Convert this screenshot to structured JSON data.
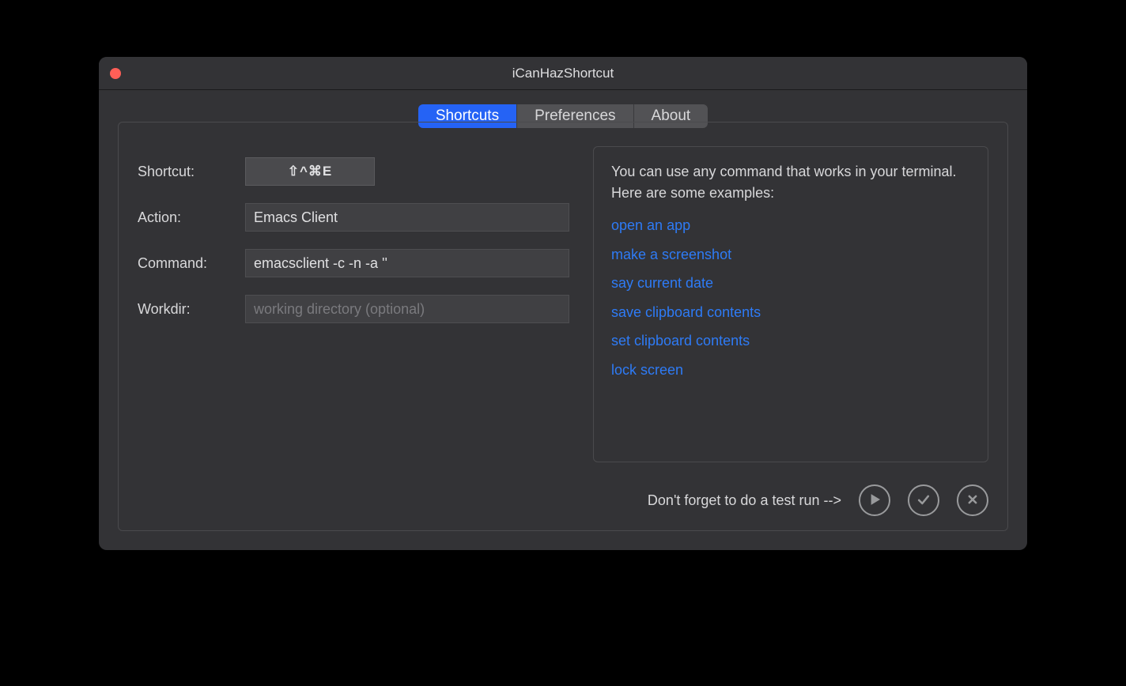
{
  "window": {
    "title": "iCanHazShortcut"
  },
  "tabs": {
    "shortcuts": "Shortcuts",
    "preferences": "Preferences",
    "about": "About",
    "active": "shortcuts"
  },
  "form": {
    "shortcut_label": "Shortcut:",
    "shortcut_value": "⇧^⌘E",
    "action_label": "Action:",
    "action_value": "Emacs Client",
    "command_label": "Command:",
    "command_value": "emacsclient -c -n -a ''",
    "workdir_label": "Workdir:",
    "workdir_value": "",
    "workdir_placeholder": "working directory (optional)"
  },
  "info": {
    "intro": "You can use any command that works in your terminal. Here are some examples:",
    "examples": [
      "open an app",
      "make a screenshot",
      "say current date",
      "save clipboard contents",
      "set clipboard contents",
      "lock screen"
    ]
  },
  "footer": {
    "hint": "Don't forget to do a test run -->"
  }
}
